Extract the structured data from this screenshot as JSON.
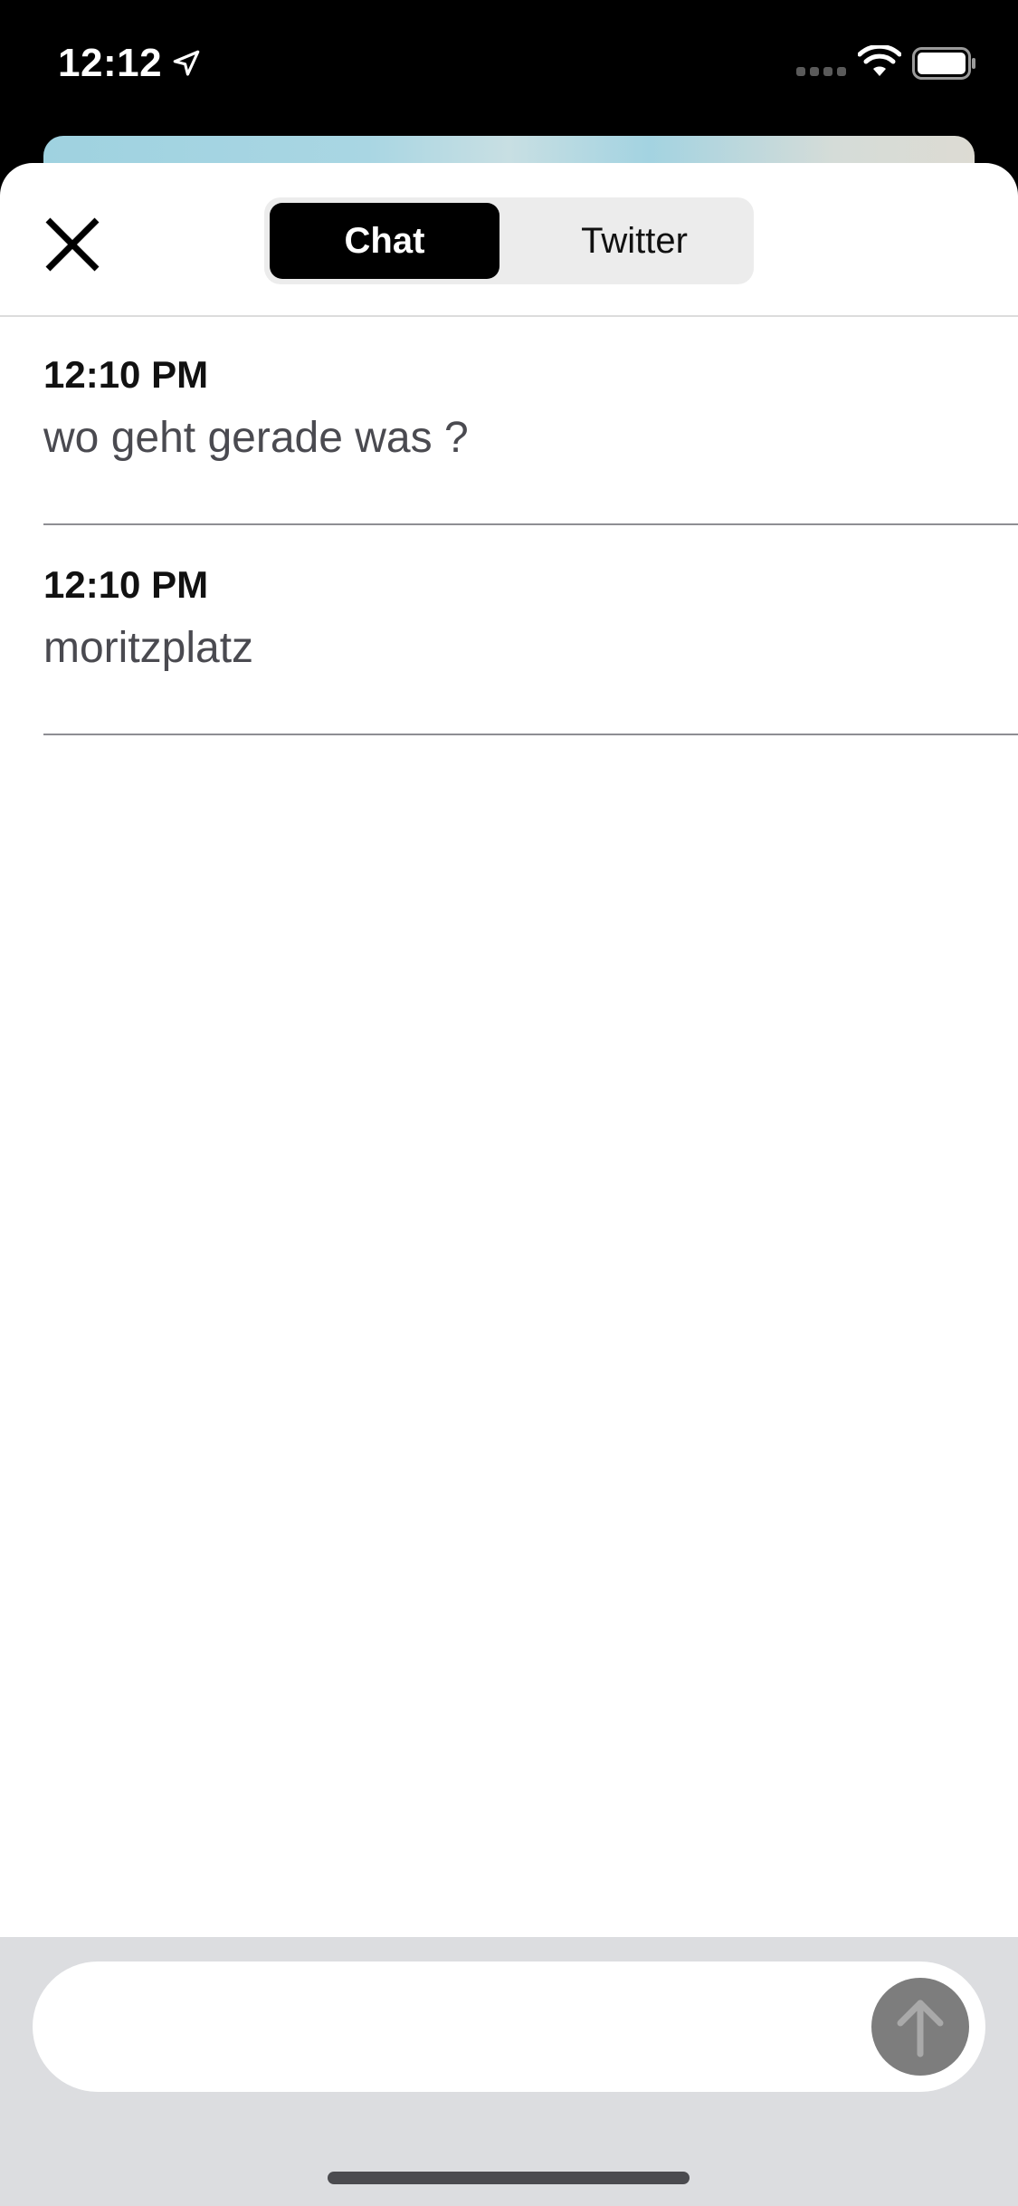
{
  "status_bar": {
    "time": "12:12",
    "icons": [
      "location-arrow-icon",
      "cellular-signal-icon",
      "wifi-icon",
      "battery-icon"
    ]
  },
  "header": {
    "close_icon": "close-icon",
    "tabs": [
      {
        "label": "Chat",
        "selected": true
      },
      {
        "label": "Twitter",
        "selected": false
      }
    ]
  },
  "messages": [
    {
      "time": "12:10 PM",
      "text": "wo geht gerade was ?"
    },
    {
      "time": "12:10 PM",
      "text": "moritzplatz"
    }
  ],
  "composer": {
    "value": "",
    "placeholder": "",
    "send_icon": "arrow-up-icon",
    "send_color": "#7d7d7d"
  },
  "colors": {
    "selected_tab": "#000000",
    "tab_background": "#ececec",
    "composer_background": "#dcdde0",
    "message_text": "#4a4a50"
  }
}
